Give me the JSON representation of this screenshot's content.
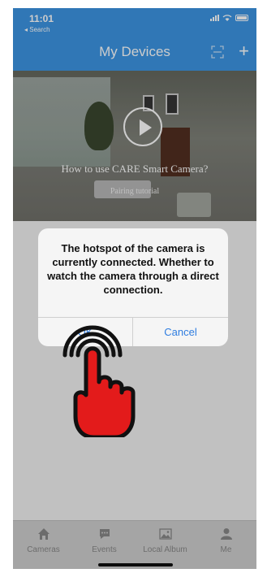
{
  "status_bar": {
    "time": "11:01",
    "back_label": "◂ Search"
  },
  "header": {
    "title": "My Devices",
    "scan_icon": "scan-icon",
    "add_icon": "plus-icon"
  },
  "banner": {
    "title": "How to use CARE Smart Camera?",
    "subtitle": "Pairing tutorial",
    "play_icon": "play-icon"
  },
  "dialog": {
    "message": "The hotspot of the camera is currently connected. Whether to watch the camera through a direct connection.",
    "confirm_label": "OK",
    "cancel_label": "Cancel"
  },
  "tabbar": {
    "items": [
      {
        "label": "Cameras",
        "icon": "home-icon"
      },
      {
        "label": "Events",
        "icon": "chat-icon"
      },
      {
        "label": "Local Album",
        "icon": "image-icon"
      },
      {
        "label": "Me",
        "icon": "person-icon"
      }
    ]
  },
  "colors": {
    "header": "#3d95e4",
    "link": "#2f7de0",
    "hand": "#e31b1b"
  }
}
